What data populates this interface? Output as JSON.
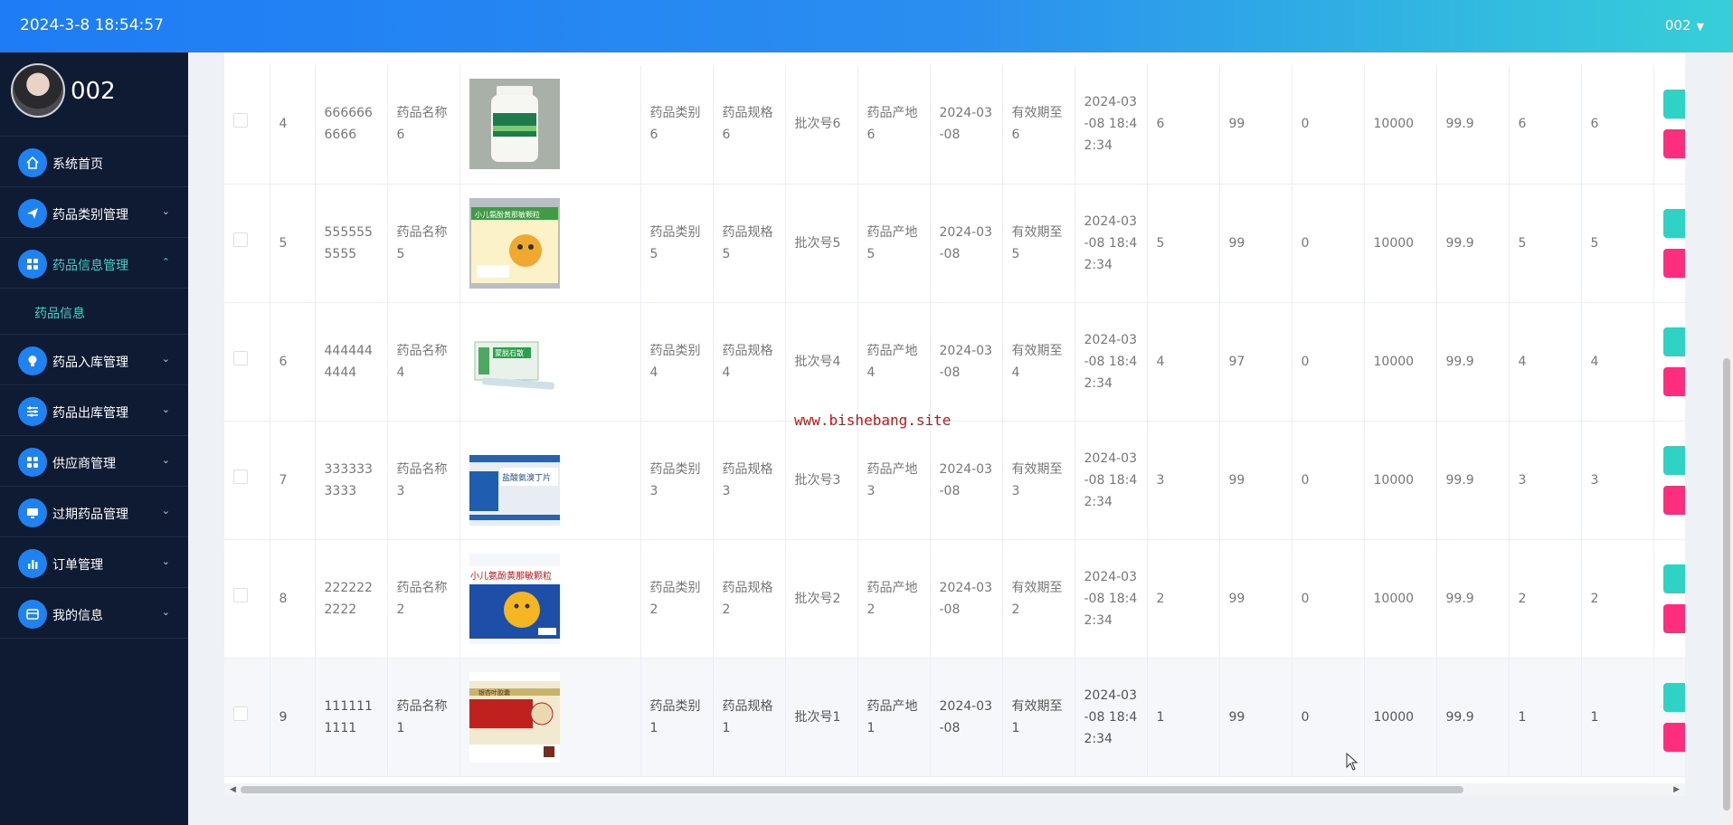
{
  "header": {
    "datetime": "2024-3-8 18:54:57",
    "user": "002"
  },
  "profile": {
    "name": "002"
  },
  "sidebar": {
    "items": [
      {
        "label": "系统首页",
        "icon": "home-icon",
        "chevron": ""
      },
      {
        "label": "药品类别管理",
        "icon": "send-icon",
        "chevron": "⌄"
      },
      {
        "label": "药品信息管理",
        "icon": "grid-icon",
        "chevron": "⌃",
        "active": true
      },
      {
        "label": "药品入库管理",
        "icon": "bulb-icon",
        "chevron": "⌄"
      },
      {
        "label": "药品出库管理",
        "icon": "sliders-icon",
        "chevron": "⌄"
      },
      {
        "label": "供应商管理",
        "icon": "apps-icon",
        "chevron": "⌄"
      },
      {
        "label": "过期药品管理",
        "icon": "monitor-icon",
        "chevron": "⌄"
      },
      {
        "label": "订单管理",
        "icon": "bar-chart-icon",
        "chevron": "⌄"
      },
      {
        "label": "我的信息",
        "icon": "card-icon",
        "chevron": "⌄"
      }
    ],
    "submenu": {
      "label": "药品信息"
    }
  },
  "rows": [
    {
      "idx": "4",
      "code": "6666666666",
      "name": "药品名称6",
      "category": "药品类别6",
      "spec": "药品规格6",
      "batch": "批次号6",
      "origin": "药品产地6",
      "date": "2024-03-08",
      "expiry": "有效期至6",
      "created": "2024-03-08 18:42:34",
      "c1": "6",
      "c2": "99",
      "c3": "0",
      "c4": "10000",
      "c5": "99.9",
      "c6": "6",
      "c7": "6",
      "image": "bottle"
    },
    {
      "idx": "5",
      "code": "5555555555",
      "name": "药品名称5",
      "category": "药品类别5",
      "spec": "药品规格5",
      "batch": "批次号5",
      "origin": "药品产地5",
      "date": "2024-03-08",
      "expiry": "有效期至5",
      "created": "2024-03-08 18:42:34",
      "c1": "5",
      "c2": "99",
      "c3": "0",
      "c4": "10000",
      "c5": "99.9",
      "c6": "5",
      "c7": "5",
      "image": "kids-box"
    },
    {
      "idx": "6",
      "code": "4444444444",
      "name": "药品名称4",
      "category": "药品类别4",
      "spec": "药品规格4",
      "batch": "批次号4",
      "origin": "药品产地4",
      "date": "2024-03-08",
      "expiry": "有效期至4",
      "created": "2024-03-08 18:42:34",
      "c1": "4",
      "c2": "97",
      "c3": "0",
      "c4": "10000",
      "c5": "99.9",
      "c6": "4",
      "c7": "4",
      "image": "ointment"
    },
    {
      "idx": "7",
      "code": "3333333333",
      "name": "药品名称3",
      "category": "药品类别3",
      "spec": "药品规格3",
      "batch": "批次号3",
      "origin": "药品产地3",
      "date": "2024-03-08",
      "expiry": "有效期至3",
      "created": "2024-03-08 18:42:34",
      "c1": "3",
      "c2": "99",
      "c3": "0",
      "c4": "10000",
      "c5": "99.9",
      "c6": "3",
      "c7": "3",
      "image": "tablet-box"
    },
    {
      "idx": "8",
      "code": "2222222222",
      "name": "药品名称2",
      "category": "药品类别2",
      "spec": "药品规格2",
      "batch": "批次号2",
      "origin": "药品产地2",
      "date": "2024-03-08",
      "expiry": "有效期至2",
      "created": "2024-03-08 18:42:34",
      "c1": "2",
      "c2": "99",
      "c3": "0",
      "c4": "10000",
      "c5": "99.9",
      "c6": "2",
      "c7": "2",
      "image": "granule-box"
    },
    {
      "idx": "9",
      "code": "1111111111",
      "name": "药品名称1",
      "category": "药品类别1",
      "spec": "药品规格1",
      "batch": "批次号1",
      "origin": "药品产地1",
      "date": "2024-03-08",
      "expiry": "有效期至1",
      "created": "2024-03-08 18:42:34",
      "c1": "1",
      "c2": "99",
      "c3": "0",
      "c4": "10000",
      "c5": "99.9",
      "c6": "1",
      "c7": "1",
      "image": "red-box"
    }
  ],
  "image_text": {
    "kids": "小儿氨酚黄那敏颗粒",
    "ointment": "蒙脱石散",
    "tablet": "盐酸氨溴丁片",
    "granule": "小儿氨酚黄那敏颗粒",
    "red": "银杏叶胶囊"
  },
  "watermark": "www.bishebang.site",
  "colors": {
    "accent": "#1e82f0",
    "active": "#3fd3c8",
    "edit": "#2fd3c5",
    "delete": "#ff2d7d",
    "sidebar": "#0f1b33"
  }
}
